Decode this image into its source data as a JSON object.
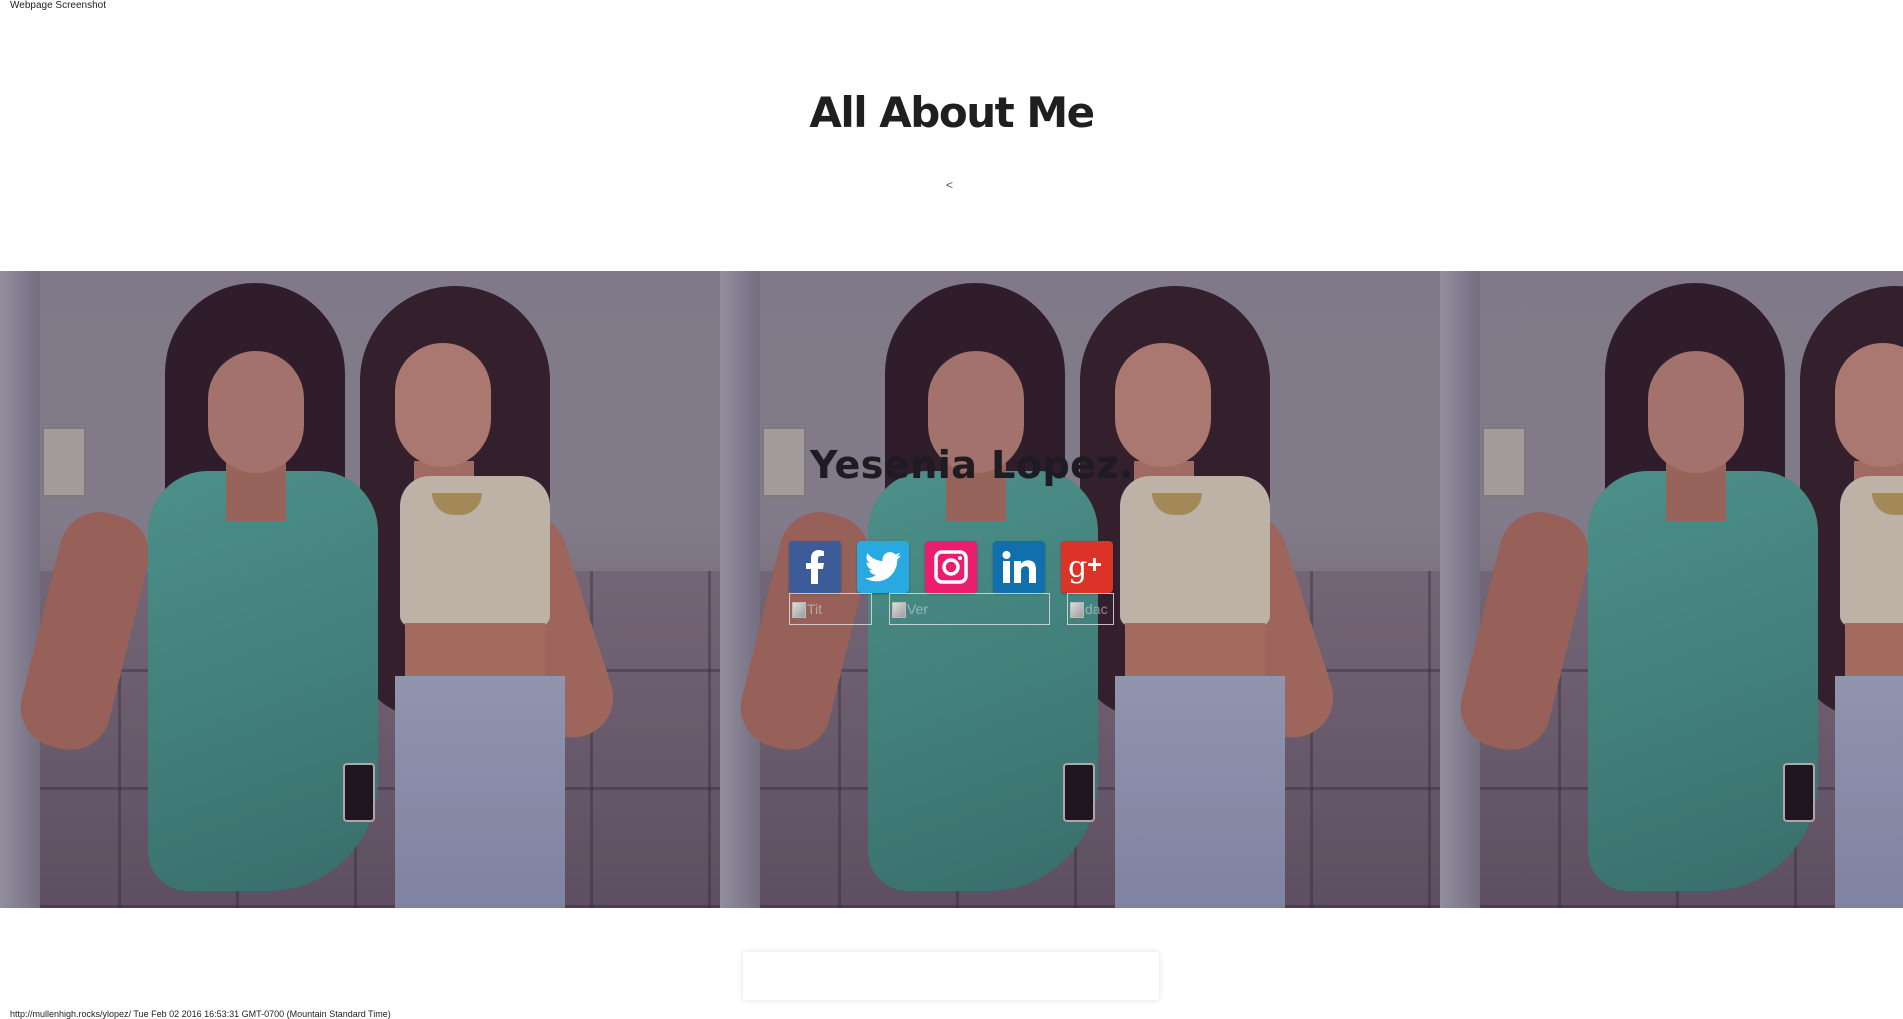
{
  "screenshot_caption": "Webpage Screenshot",
  "header": {
    "title": "All About Me",
    "small_glyph": "<"
  },
  "hero": {
    "name": "Yesenia Lopez.",
    "social": [
      {
        "network": "Facebook",
        "icon": "facebook-icon",
        "color": "#3b5b99"
      },
      {
        "network": "Twitter",
        "icon": "twitter-icon",
        "color": "#28a9e1"
      },
      {
        "network": "Instagram",
        "icon": "instagram-icon",
        "color": "#ec1c6f"
      },
      {
        "network": "LinkedIn",
        "icon": "linkedin-icon",
        "color": "#0f70ad"
      },
      {
        "network": "Google+",
        "icon": "google-plus-icon",
        "color": "#db3327"
      }
    ],
    "broken_images": [
      {
        "alt": "Tit"
      },
      {
        "alt": "Ver"
      },
      {
        "alt": "dac"
      }
    ]
  },
  "footer": {
    "capture_info": "http://mullenhigh.rocks/ylopez/ Tue Feb 02 2016 16:53:31 GMT-0700 (Mountain Standard Time)"
  }
}
